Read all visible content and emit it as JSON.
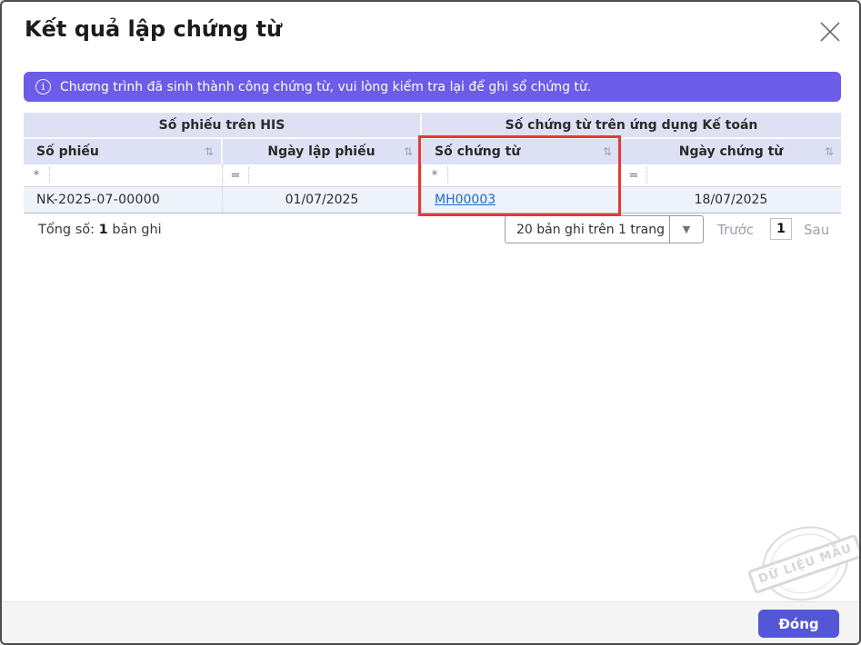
{
  "dialog": {
    "title": "Kết quả lập chứng từ"
  },
  "banner": {
    "icon": "info-icon",
    "icon_glyph": "i",
    "text": "Chương trình đã sinh thành công chứng từ, vui lòng kiểm tra lại để ghi sổ chứng từ."
  },
  "table": {
    "groups": [
      {
        "label": "Số phiếu trên HIS"
      },
      {
        "label": "Số chứng từ trên ứng dụng Kế toán"
      }
    ],
    "columns": [
      {
        "label": "Số phiếu",
        "filter_op": "*",
        "sort_icon": "⇅"
      },
      {
        "label": "Ngày lập phiếu",
        "filter_op": "=",
        "sort_icon": "⇅"
      },
      {
        "label": "Số chứng từ",
        "filter_op": "*",
        "sort_icon": "⇅",
        "highlighted": true
      },
      {
        "label": "Ngày chứng từ",
        "filter_op": "=",
        "sort_icon": "⇅"
      }
    ],
    "rows": [
      {
        "so_phieu": "NK-2025-07-00000",
        "ngay_lap_phieu": "01/07/2025",
        "so_chung_tu": "MH00003",
        "ngay_chung_tu": "18/07/2025"
      }
    ]
  },
  "pagination": {
    "total_label": "Tổng số:",
    "total_count": "1",
    "total_suffix": "bản ghi",
    "page_size_label": "20 bản ghi trên 1 trang",
    "dropdown_caret": "▼",
    "prev_label": "Trước",
    "current_page": "1",
    "next_label": "Sau"
  },
  "watermark": {
    "text": "DỮ LIỆU MẪU"
  },
  "footer": {
    "close_button_label": "Đóng"
  },
  "colors": {
    "banner_bg": "#6c5ce7",
    "header_bg": "#dee0f3",
    "data_row_bg": "#edf2fb",
    "highlight_red": "#e53935",
    "link_blue": "#1c6cc8",
    "button_bg": "#5357d6"
  }
}
